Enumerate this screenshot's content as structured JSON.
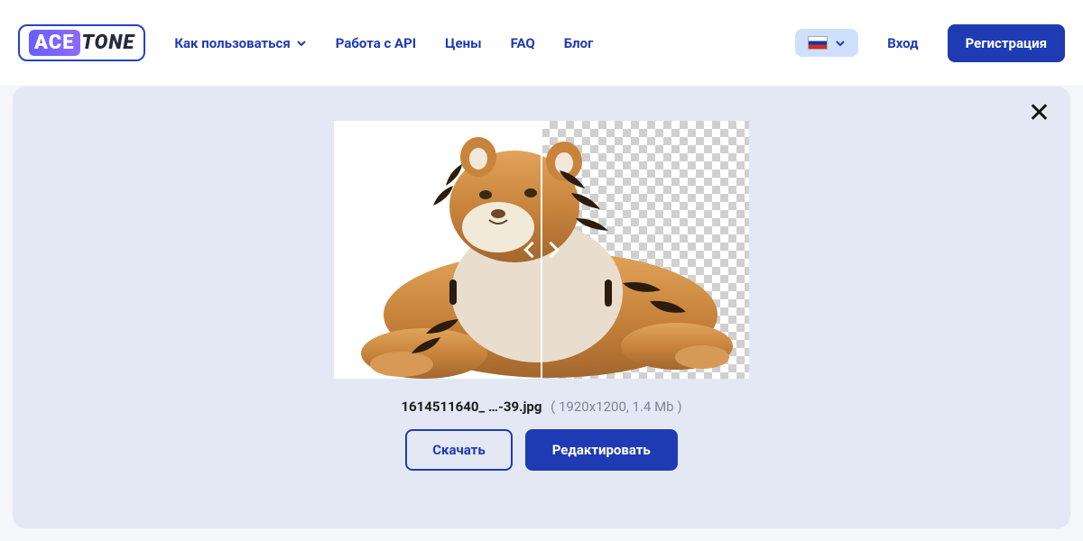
{
  "logo": {
    "left": "ACE",
    "right": "TONE"
  },
  "nav": {
    "howto": "Как пользоваться",
    "api": "Работа с API",
    "pricing": "Цены",
    "faq": "FAQ",
    "blog": "Блог"
  },
  "auth": {
    "login": "Вход",
    "register": "Регистрация"
  },
  "lang": {
    "code": "ru"
  },
  "file": {
    "name": "1614511640_ …-39.jpg",
    "meta": "( 1920x1200, 1.4 Mb )"
  },
  "actions": {
    "download": "Скачать",
    "edit": "Редактировать"
  }
}
